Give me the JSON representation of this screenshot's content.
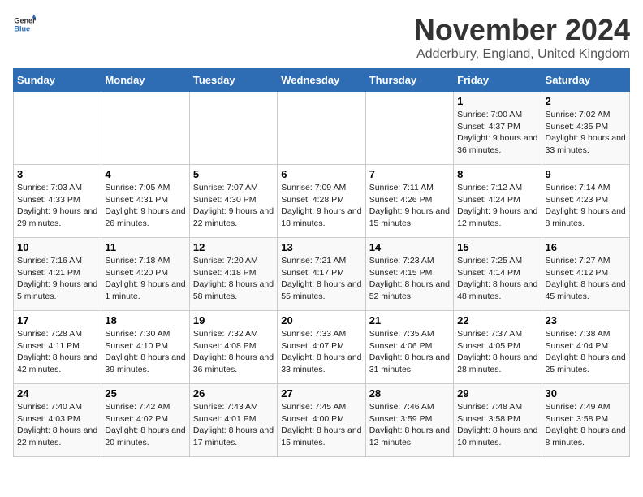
{
  "logo": {
    "general": "General",
    "blue": "Blue"
  },
  "title": "November 2024",
  "location": "Adderbury, England, United Kingdom",
  "days_of_week": [
    "Sunday",
    "Monday",
    "Tuesday",
    "Wednesday",
    "Thursday",
    "Friday",
    "Saturday"
  ],
  "weeks": [
    [
      {
        "day": "",
        "info": ""
      },
      {
        "day": "",
        "info": ""
      },
      {
        "day": "",
        "info": ""
      },
      {
        "day": "",
        "info": ""
      },
      {
        "day": "",
        "info": ""
      },
      {
        "day": "1",
        "info": "Sunrise: 7:00 AM\nSunset: 4:37 PM\nDaylight: 9 hours and 36 minutes."
      },
      {
        "day": "2",
        "info": "Sunrise: 7:02 AM\nSunset: 4:35 PM\nDaylight: 9 hours and 33 minutes."
      }
    ],
    [
      {
        "day": "3",
        "info": "Sunrise: 7:03 AM\nSunset: 4:33 PM\nDaylight: 9 hours and 29 minutes."
      },
      {
        "day": "4",
        "info": "Sunrise: 7:05 AM\nSunset: 4:31 PM\nDaylight: 9 hours and 26 minutes."
      },
      {
        "day": "5",
        "info": "Sunrise: 7:07 AM\nSunset: 4:30 PM\nDaylight: 9 hours and 22 minutes."
      },
      {
        "day": "6",
        "info": "Sunrise: 7:09 AM\nSunset: 4:28 PM\nDaylight: 9 hours and 18 minutes."
      },
      {
        "day": "7",
        "info": "Sunrise: 7:11 AM\nSunset: 4:26 PM\nDaylight: 9 hours and 15 minutes."
      },
      {
        "day": "8",
        "info": "Sunrise: 7:12 AM\nSunset: 4:24 PM\nDaylight: 9 hours and 12 minutes."
      },
      {
        "day": "9",
        "info": "Sunrise: 7:14 AM\nSunset: 4:23 PM\nDaylight: 9 hours and 8 minutes."
      }
    ],
    [
      {
        "day": "10",
        "info": "Sunrise: 7:16 AM\nSunset: 4:21 PM\nDaylight: 9 hours and 5 minutes."
      },
      {
        "day": "11",
        "info": "Sunrise: 7:18 AM\nSunset: 4:20 PM\nDaylight: 9 hours and 1 minute."
      },
      {
        "day": "12",
        "info": "Sunrise: 7:20 AM\nSunset: 4:18 PM\nDaylight: 8 hours and 58 minutes."
      },
      {
        "day": "13",
        "info": "Sunrise: 7:21 AM\nSunset: 4:17 PM\nDaylight: 8 hours and 55 minutes."
      },
      {
        "day": "14",
        "info": "Sunrise: 7:23 AM\nSunset: 4:15 PM\nDaylight: 8 hours and 52 minutes."
      },
      {
        "day": "15",
        "info": "Sunrise: 7:25 AM\nSunset: 4:14 PM\nDaylight: 8 hours and 48 minutes."
      },
      {
        "day": "16",
        "info": "Sunrise: 7:27 AM\nSunset: 4:12 PM\nDaylight: 8 hours and 45 minutes."
      }
    ],
    [
      {
        "day": "17",
        "info": "Sunrise: 7:28 AM\nSunset: 4:11 PM\nDaylight: 8 hours and 42 minutes."
      },
      {
        "day": "18",
        "info": "Sunrise: 7:30 AM\nSunset: 4:10 PM\nDaylight: 8 hours and 39 minutes."
      },
      {
        "day": "19",
        "info": "Sunrise: 7:32 AM\nSunset: 4:08 PM\nDaylight: 8 hours and 36 minutes."
      },
      {
        "day": "20",
        "info": "Sunrise: 7:33 AM\nSunset: 4:07 PM\nDaylight: 8 hours and 33 minutes."
      },
      {
        "day": "21",
        "info": "Sunrise: 7:35 AM\nSunset: 4:06 PM\nDaylight: 8 hours and 31 minutes."
      },
      {
        "day": "22",
        "info": "Sunrise: 7:37 AM\nSunset: 4:05 PM\nDaylight: 8 hours and 28 minutes."
      },
      {
        "day": "23",
        "info": "Sunrise: 7:38 AM\nSunset: 4:04 PM\nDaylight: 8 hours and 25 minutes."
      }
    ],
    [
      {
        "day": "24",
        "info": "Sunrise: 7:40 AM\nSunset: 4:03 PM\nDaylight: 8 hours and 22 minutes."
      },
      {
        "day": "25",
        "info": "Sunrise: 7:42 AM\nSunset: 4:02 PM\nDaylight: 8 hours and 20 minutes."
      },
      {
        "day": "26",
        "info": "Sunrise: 7:43 AM\nSunset: 4:01 PM\nDaylight: 8 hours and 17 minutes."
      },
      {
        "day": "27",
        "info": "Sunrise: 7:45 AM\nSunset: 4:00 PM\nDaylight: 8 hours and 15 minutes."
      },
      {
        "day": "28",
        "info": "Sunrise: 7:46 AM\nSunset: 3:59 PM\nDaylight: 8 hours and 12 minutes."
      },
      {
        "day": "29",
        "info": "Sunrise: 7:48 AM\nSunset: 3:58 PM\nDaylight: 8 hours and 10 minutes."
      },
      {
        "day": "30",
        "info": "Sunrise: 7:49 AM\nSunset: 3:58 PM\nDaylight: 8 hours and 8 minutes."
      }
    ]
  ]
}
